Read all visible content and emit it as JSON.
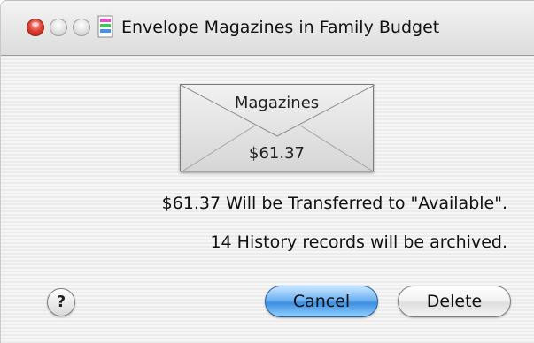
{
  "window": {
    "title": "Envelope Magazines in Family Budget",
    "app_icon": "budget-app-icon"
  },
  "envelope": {
    "name": "Magazines",
    "amount": "$61.37"
  },
  "messages": {
    "transfer": "$61.37 Will be Transferred to \"Available\".",
    "archive": "14 History records will be archived."
  },
  "buttons": {
    "help": "?",
    "cancel": "Cancel",
    "delete": "Delete"
  },
  "colors": {
    "close_button": "#e2453a",
    "default_button": "#3d8ee0"
  }
}
